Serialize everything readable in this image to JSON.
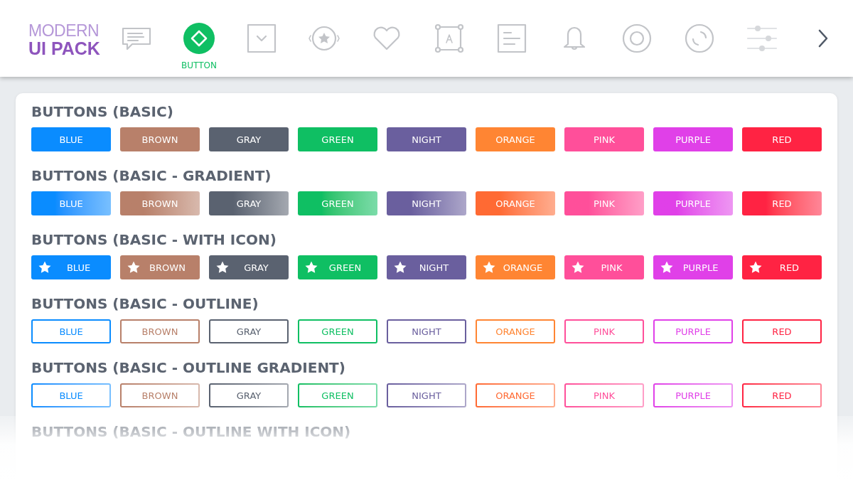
{
  "logo": {
    "line_1": "MODERN",
    "line_2": "UI PACK"
  },
  "nav": {
    "items": [
      {
        "kind": "chat",
        "selected": false
      },
      {
        "kind": "button",
        "selected": true,
        "label": "BUTTON"
      },
      {
        "kind": "dropdown",
        "selected": false
      },
      {
        "kind": "carousel",
        "selected": false
      },
      {
        "kind": "heart",
        "selected": false
      },
      {
        "kind": "textbox",
        "selected": false
      },
      {
        "kind": "list",
        "selected": false
      },
      {
        "kind": "bell",
        "selected": false
      },
      {
        "kind": "radio",
        "selected": false
      },
      {
        "kind": "loader",
        "selected": false
      },
      {
        "kind": "sliders",
        "selected": false
      }
    ]
  },
  "sections": [
    {
      "title": "BUTTONS (BASIC)",
      "kind": "solid",
      "buttons": [
        {
          "label": "BLUE",
          "color": "#0a8cff"
        },
        {
          "label": "BROWN",
          "color": "#b8806a"
        },
        {
          "label": "GRAY",
          "color": "#5a6270"
        },
        {
          "label": "GREEN",
          "color": "#0fbf63"
        },
        {
          "label": "NIGHT",
          "color": "#6a5f9e"
        },
        {
          "label": "ORANGE",
          "color": "#ff8533"
        },
        {
          "label": "PINK",
          "color": "#ff4f9a"
        },
        {
          "label": "PURPLE",
          "color": "#e040e8"
        },
        {
          "label": "RED",
          "color": "#ff2343"
        }
      ]
    },
    {
      "title": "BUTTONS (BASIC - GRADIENT)",
      "kind": "gradient",
      "buttons": [
        {
          "label": "BLUE",
          "color": "#0a8cff"
        },
        {
          "label": "BROWN",
          "color": "#b8806a"
        },
        {
          "label": "GRAY",
          "color": "#5a6270"
        },
        {
          "label": "GREEN",
          "color": "#0fbf63"
        },
        {
          "label": "NIGHT",
          "color": "#6a5f9e"
        },
        {
          "label": "ORANGE",
          "color": "#ff6a33"
        },
        {
          "label": "PINK",
          "color": "#ff4f9a"
        },
        {
          "label": "PURPLE",
          "color": "#e040e8"
        },
        {
          "label": "RED",
          "color": "#ff2343"
        }
      ]
    },
    {
      "title": "BUTTONS (BASIC - WITH ICON)",
      "kind": "icon",
      "buttons": [
        {
          "label": "BLUE",
          "color": "#0a8cff"
        },
        {
          "label": "BROWN",
          "color": "#b8806a"
        },
        {
          "label": "GRAY",
          "color": "#5a6270"
        },
        {
          "label": "GREEN",
          "color": "#0fbf63"
        },
        {
          "label": "NIGHT",
          "color": "#6a5f9e"
        },
        {
          "label": "ORANGE",
          "color": "#ff8533"
        },
        {
          "label": "PINK",
          "color": "#ff4f9a"
        },
        {
          "label": "PURPLE",
          "color": "#e040e8"
        },
        {
          "label": "RED",
          "color": "#ff2343"
        }
      ]
    },
    {
      "title": "BUTTONS (BASIC - OUTLINE)",
      "kind": "outline",
      "buttons": [
        {
          "label": "BLUE",
          "color": "#0a8cff"
        },
        {
          "label": "BROWN",
          "color": "#b8806a"
        },
        {
          "label": "GRAY",
          "color": "#5a6270"
        },
        {
          "label": "GREEN",
          "color": "#0fbf63"
        },
        {
          "label": "NIGHT",
          "color": "#6a5f9e"
        },
        {
          "label": "ORANGE",
          "color": "#ff8533"
        },
        {
          "label": "PINK",
          "color": "#ff4f9a"
        },
        {
          "label": "PURPLE",
          "color": "#e040e8"
        },
        {
          "label": "RED",
          "color": "#ff2343"
        }
      ]
    },
    {
      "title": "BUTTONS (BASIC - OUTLINE GRADIENT)",
      "kind": "outline-gradient",
      "buttons": [
        {
          "label": "BLUE",
          "color": "#0a8cff"
        },
        {
          "label": "BROWN",
          "color": "#b8806a"
        },
        {
          "label": "GRAY",
          "color": "#5a6270"
        },
        {
          "label": "GREEN",
          "color": "#0fbf63"
        },
        {
          "label": "NIGHT",
          "color": "#6a5f9e"
        },
        {
          "label": "ORANGE",
          "color": "#ff6a33"
        },
        {
          "label": "PINK",
          "color": "#ff4f9a"
        },
        {
          "label": "PURPLE",
          "color": "#e040e8"
        },
        {
          "label": "RED",
          "color": "#ff2343"
        }
      ]
    },
    {
      "title": "BUTTONS (BASIC - OUTLINE WITH ICON)"
    }
  ]
}
